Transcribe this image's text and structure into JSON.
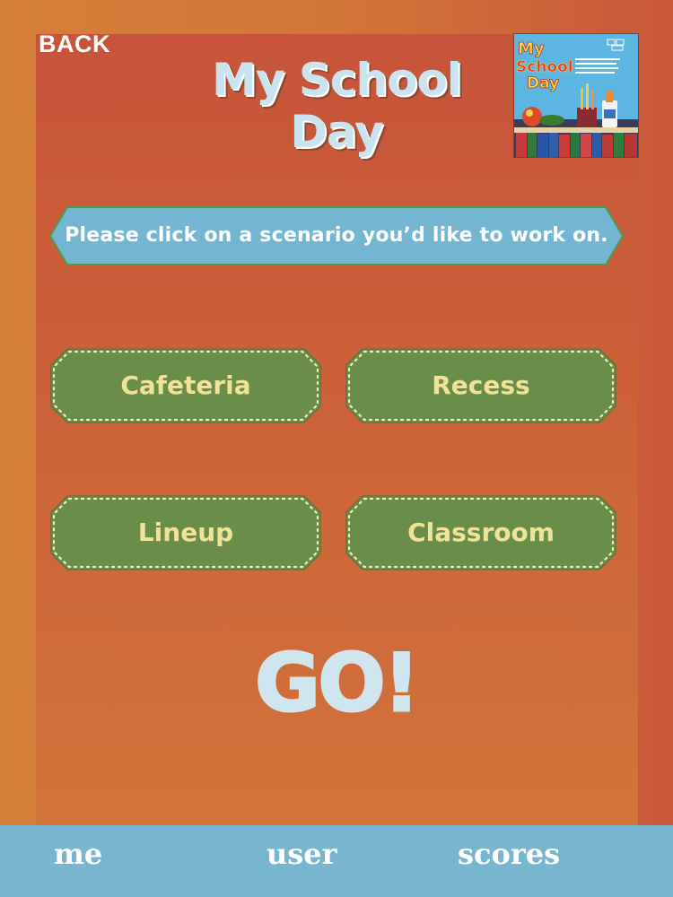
{
  "header": {
    "back_label": "BACK",
    "title_line1": "My School",
    "title_line2": "Day",
    "cover": {
      "title_line1": "My",
      "title_line2": "School",
      "title_line3": "Day"
    }
  },
  "instruction": "Please click on a scenario you’d like to work on.",
  "scenarios": [
    {
      "label": "Cafeteria"
    },
    {
      "label": "Recess"
    },
    {
      "label": "Lineup"
    },
    {
      "label": "Classroom"
    }
  ],
  "go_label": "GO!",
  "bottom_tabs": [
    {
      "label": "me"
    },
    {
      "label": "user"
    },
    {
      "label": "scores"
    }
  ],
  "colors": {
    "background": "#cc6139",
    "instruction_fill": "#74b6d2",
    "instruction_border": "#4e9a4e",
    "scenario_fill": "#6a8e49",
    "scenario_text": "#efe39a",
    "title": "#c9e4ee",
    "bottom_bar": "#78b6d0"
  }
}
